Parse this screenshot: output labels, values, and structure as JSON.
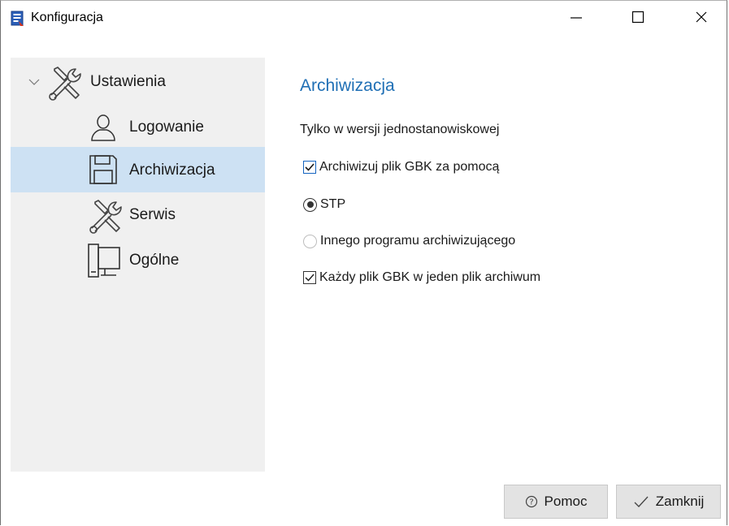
{
  "window": {
    "title": "Konfiguracja"
  },
  "sidebar": {
    "items": [
      {
        "label": "Ustawienia",
        "icon": "tools-icon"
      },
      {
        "label": "Logowanie",
        "icon": "user-icon"
      },
      {
        "label": "Archiwizacja",
        "icon": "floppy-disk-icon",
        "selected": true
      },
      {
        "label": "Serwis",
        "icon": "tools-icon"
      },
      {
        "label": "Ogólne",
        "icon": "computer-icon"
      }
    ]
  },
  "content": {
    "title": "Archiwizacja",
    "subtitle": "Tylko w wersji jednostanowiskowej",
    "options": {
      "archive_checkbox": {
        "label": "Archiwizuj plik GBK za pomocą",
        "checked": true
      },
      "stp_radio": {
        "label": "STP",
        "selected": true
      },
      "other_radio": {
        "label": "Innego programu archiwizującego",
        "selected": false
      },
      "each_file_checkbox": {
        "label": "Każdy plik GBK w jeden plik archiwum",
        "checked": true
      }
    }
  },
  "buttons": {
    "help_label": "Pomoc",
    "close_label": "Zamknij"
  },
  "colors": {
    "accent": "#1f6fb5",
    "selection": "#cde1f3",
    "sidebar_bg": "#f0f0f0"
  }
}
